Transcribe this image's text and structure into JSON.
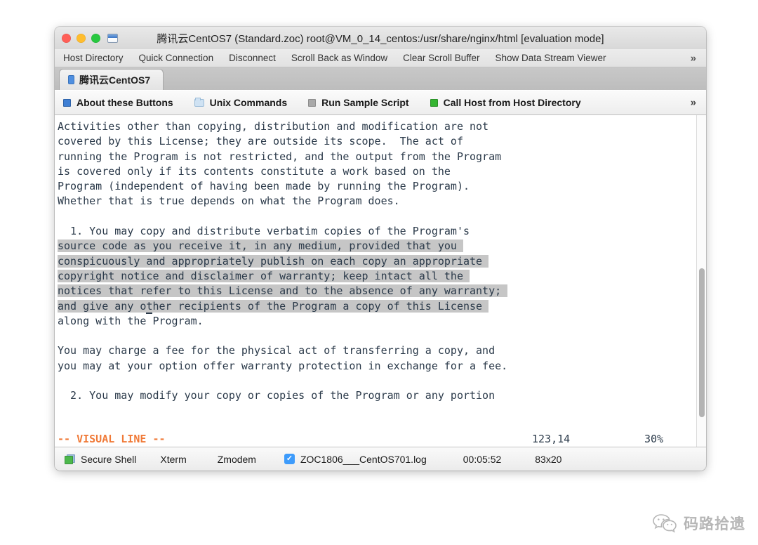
{
  "window": {
    "title_app": "腾讯云CentOS7 (Standard.zoc) root@VM_0_14_centos:/usr/share/nginx/html [evaluation mode]",
    "traffic_lights": [
      "close-button",
      "minimize-button",
      "maximize-button"
    ],
    "window_icon": "window-icon"
  },
  "menustrip": {
    "items": [
      {
        "label": "Host Directory"
      },
      {
        "label": "Quick Connection"
      },
      {
        "label": "Disconnect"
      },
      {
        "label": "Scroll Back as Window"
      },
      {
        "label": "Clear Scroll Buffer"
      },
      {
        "label": "Show Data Stream Viewer"
      }
    ],
    "overflow": "»"
  },
  "tabs": [
    {
      "label": "腾讯云CentOS7",
      "icon": "blue-square-icon",
      "active": true
    }
  ],
  "buttonbar": {
    "buttons": [
      {
        "label": "About these Buttons",
        "icon": "blue-square-icon"
      },
      {
        "label": "Unix Commands",
        "icon": "folder-icon"
      },
      {
        "label": "Run Sample Script",
        "icon": "grey-square-icon"
      },
      {
        "label": "Call Host from Host Directory",
        "icon": "green-square-icon"
      }
    ],
    "overflow": "»"
  },
  "terminal": {
    "lines": [
      {
        "pre": "Activities other than copying, distribution and modification are not",
        "sel": "",
        "post": ""
      },
      {
        "pre": "covered by this License; they are outside its scope.  The act of",
        "sel": "",
        "post": ""
      },
      {
        "pre": "running the Program is not restricted, and the output from the Program",
        "sel": "",
        "post": ""
      },
      {
        "pre": "is covered only if its contents constitute a work based on the",
        "sel": "",
        "post": ""
      },
      {
        "pre": "Program (independent of having been made by running the Program).",
        "sel": "",
        "post": ""
      },
      {
        "pre": "Whether that is true depends on what the Program does.",
        "sel": "",
        "post": ""
      },
      {
        "pre": "",
        "sel": "",
        "post": ""
      },
      {
        "pre": "  1. You may copy and distribute verbatim copies of the Program's",
        "sel": "",
        "post": ""
      },
      {
        "pre": "",
        "sel": "source code as you receive it, in any medium, provided that you ",
        "post": ""
      },
      {
        "pre": "",
        "sel": "conspicuously and appropriately publish on each copy an appropriate ",
        "post": ""
      },
      {
        "pre": "",
        "sel": "copyright notice and disclaimer of warranty; keep intact all the ",
        "post": ""
      },
      {
        "pre": "",
        "sel": "notices that refer to this License and to the absence of any warranty; ",
        "post": ""
      },
      {
        "pre": "",
        "sel": "and give any other recipients of the Program a copy of this License ",
        "post": "",
        "cursor_at": 14
      },
      {
        "pre": "along with the Program.",
        "sel": "",
        "post": ""
      },
      {
        "pre": "",
        "sel": "",
        "post": ""
      },
      {
        "pre": "You may charge a fee for the physical act of transferring a copy, and",
        "sel": "",
        "post": ""
      },
      {
        "pre": "you may at your option offer warranty protection in exchange for a fee.",
        "sel": "",
        "post": ""
      },
      {
        "pre": "",
        "sel": "",
        "post": ""
      },
      {
        "pre": "  2. You may modify your copy or copies of the Program or any portion",
        "sel": "",
        "post": ""
      }
    ],
    "statusline": {
      "mode": "-- VISUAL LINE --",
      "position": "123,14",
      "percent": "30%"
    },
    "scrollbar": "vertical-scrollbar"
  },
  "statusbar": {
    "connection": "Secure Shell",
    "emulation": "Xterm",
    "transfer": "Zmodem",
    "logfile": "ZOC1806___CentOS701.log",
    "logging_checked": true,
    "check_glyph": "✓",
    "elapsed": "00:05:52",
    "dimensions": "83x20"
  },
  "watermark": {
    "text": "码路拾遗",
    "icon": "wechat-icon"
  },
  "colors": {
    "vim_mode_orange": "#f07a38",
    "terminal_fg": "#2b3a4a",
    "selection_bg": "#c6c6c6",
    "accent_blue": "#3d9bfb"
  }
}
